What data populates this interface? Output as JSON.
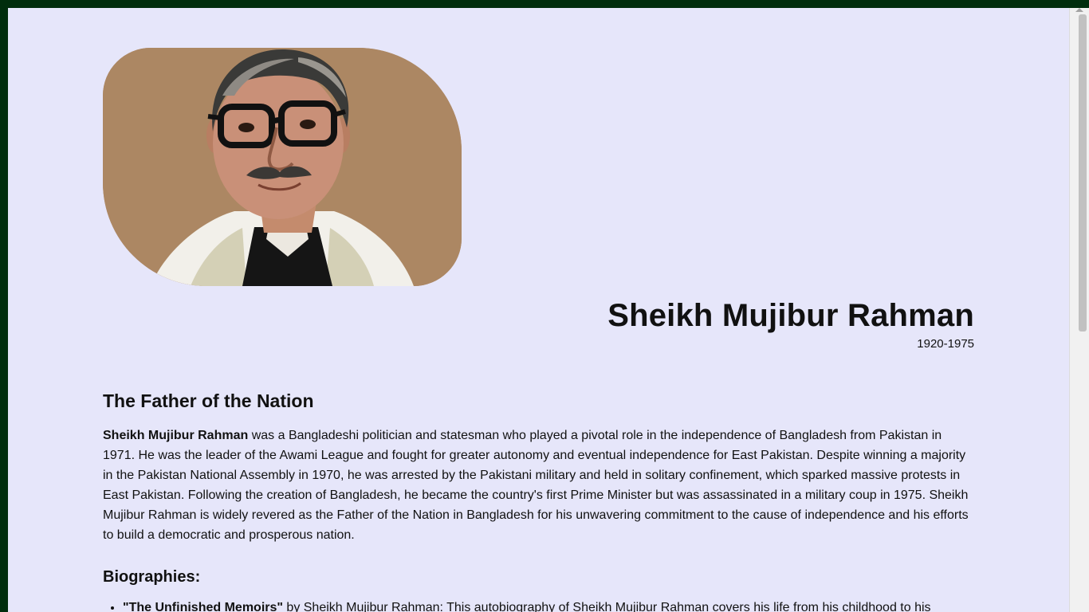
{
  "profile": {
    "portrait_alt": "Sheikh Mujibur Rahman",
    "name": "Sheikh Mujibur Rahman",
    "years": "1920-1975"
  },
  "about": {
    "heading": "The Father of the Nation",
    "bold_name": "Sheikh Mujibur Rahman",
    "text": " was a Bangladeshi politician and statesman who played a pivotal role in the independence of Bangladesh from Pakistan in 1971. He was the leader of the Awami League and fought for greater autonomy and eventual independence for East Pakistan. Despite winning a majority in the Pakistan National Assembly in 1970, he was arrested by the Pakistani military and held in solitary confinement, which sparked massive protests in East Pakistan. Following the creation of Bangladesh, he became the country's first Prime Minister but was assassinated in a military coup in 1975. Sheikh Mujibur Rahman is widely revered as the Father of the Nation in Bangladesh for his unwavering commitment to the cause of independence and his efforts to build a democratic and prosperous nation."
  },
  "biographies": {
    "heading": "Biographies:",
    "items": [
      {
        "title": "\"The Unfinished Memoirs\"",
        "text": " by Sheikh Mujibur Rahman: This autobiography of Sheikh Mujibur Rahman covers his life from his childhood to his"
      }
    ]
  },
  "colors": {
    "frame": "#002d0d",
    "page_background": "#e6e6fa",
    "text": "#111111"
  }
}
